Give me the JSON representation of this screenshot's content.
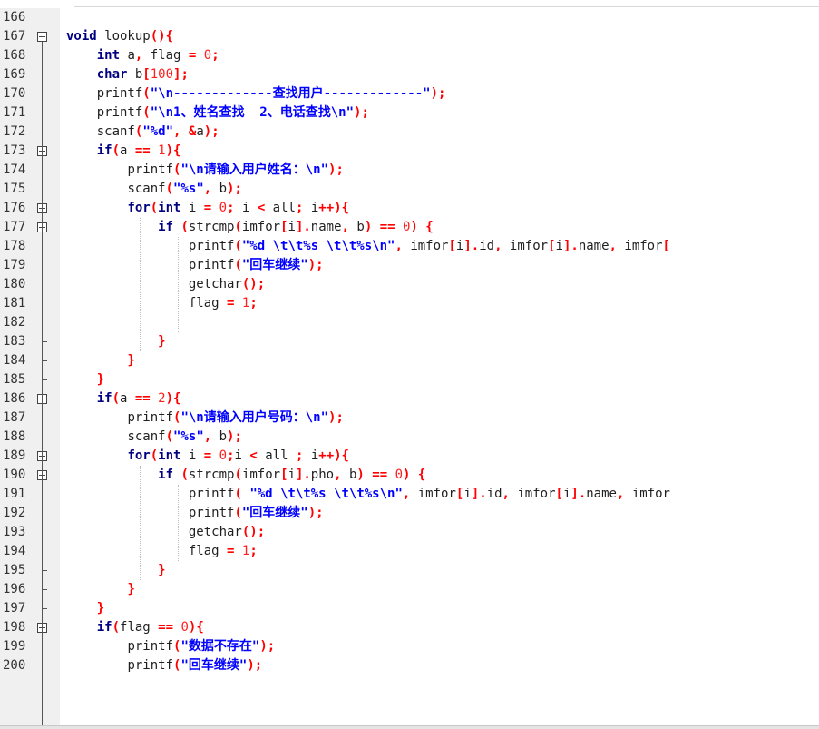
{
  "colors": {
    "keyword": "#000080",
    "string": "#0000ff",
    "number": "#ff2020",
    "operator": "#ff0000",
    "identifier": "#1f1f1f",
    "line_number": "#333333",
    "gutter_bg": "#f0f0f0"
  },
  "editor": {
    "lines": [
      {
        "num": "166",
        "tokens": []
      },
      {
        "num": "167",
        "tokens": [
          [
            "void",
            "k"
          ],
          [
            " lookup",
            ""
          ],
          [
            "(){",
            "o"
          ]
        ]
      },
      {
        "num": "168",
        "tokens": [
          [
            "    ",
            ""
          ],
          [
            "int",
            "k"
          ],
          [
            " a",
            ""
          ],
          [
            ",",
            "o"
          ],
          [
            " flag ",
            ""
          ],
          [
            "=",
            "o"
          ],
          [
            " ",
            ""
          ],
          [
            "0",
            "n"
          ],
          [
            ";",
            "o"
          ]
        ]
      },
      {
        "num": "169",
        "tokens": [
          [
            "    ",
            ""
          ],
          [
            "char",
            "k"
          ],
          [
            " b",
            ""
          ],
          [
            "[",
            "o"
          ],
          [
            "100",
            "n"
          ],
          [
            "];",
            "o"
          ]
        ]
      },
      {
        "num": "170",
        "tokens": [
          [
            "    ",
            ""
          ],
          [
            "printf",
            ""
          ],
          [
            "(",
            "o"
          ],
          [
            "\"\\n-------------查找用户-------------\"",
            "s"
          ],
          [
            ");",
            "o"
          ]
        ]
      },
      {
        "num": "171",
        "tokens": [
          [
            "    ",
            ""
          ],
          [
            "printf",
            ""
          ],
          [
            "(",
            "o"
          ],
          [
            "\"\\n1、姓名查找  2、电话查找\\n\"",
            "s"
          ],
          [
            ");",
            "o"
          ]
        ]
      },
      {
        "num": "172",
        "tokens": [
          [
            "    ",
            ""
          ],
          [
            "scanf",
            ""
          ],
          [
            "(",
            "o"
          ],
          [
            "\"%d\"",
            "s"
          ],
          [
            ",",
            "o"
          ],
          [
            " ",
            ""
          ],
          [
            "&",
            "o"
          ],
          [
            "a",
            ""
          ],
          [
            ");",
            "o"
          ]
        ]
      },
      {
        "num": "173",
        "tokens": [
          [
            "    ",
            ""
          ],
          [
            "if",
            "k"
          ],
          [
            "(",
            "o"
          ],
          [
            "a ",
            ""
          ],
          [
            "==",
            "o"
          ],
          [
            " ",
            ""
          ],
          [
            "1",
            "n"
          ],
          [
            "){",
            "o"
          ]
        ]
      },
      {
        "num": "174",
        "tokens": [
          [
            "        ",
            ""
          ],
          [
            "printf",
            ""
          ],
          [
            "(",
            "o"
          ],
          [
            "\"\\n请输入用户姓名：\\n\"",
            "s"
          ],
          [
            ");",
            "o"
          ]
        ]
      },
      {
        "num": "175",
        "tokens": [
          [
            "        ",
            ""
          ],
          [
            "scanf",
            ""
          ],
          [
            "(",
            "o"
          ],
          [
            "\"%s\"",
            "s"
          ],
          [
            ",",
            "o"
          ],
          [
            " b",
            ""
          ],
          [
            ");",
            "o"
          ]
        ]
      },
      {
        "num": "176",
        "tokens": [
          [
            "        ",
            ""
          ],
          [
            "for",
            "k"
          ],
          [
            "(",
            "o"
          ],
          [
            "int",
            "k"
          ],
          [
            " i ",
            ""
          ],
          [
            "=",
            "o"
          ],
          [
            " ",
            ""
          ],
          [
            "0",
            "n"
          ],
          [
            ";",
            "o"
          ],
          [
            " i ",
            ""
          ],
          [
            "<",
            "o"
          ],
          [
            " all",
            ""
          ],
          [
            ";",
            "o"
          ],
          [
            " i",
            ""
          ],
          [
            "++){",
            "o"
          ]
        ]
      },
      {
        "num": "177",
        "tokens": [
          [
            "            ",
            ""
          ],
          [
            "if",
            "k"
          ],
          [
            " ",
            ""
          ],
          [
            "(",
            "o"
          ],
          [
            "strcmp",
            ""
          ],
          [
            "(",
            "o"
          ],
          [
            "imfor",
            ""
          ],
          [
            "[",
            "o"
          ],
          [
            "i",
            ""
          ],
          [
            "].",
            "o"
          ],
          [
            "name",
            ""
          ],
          [
            ",",
            "o"
          ],
          [
            " b",
            ""
          ],
          [
            ")",
            "o"
          ],
          [
            " ",
            ""
          ],
          [
            "==",
            "o"
          ],
          [
            " ",
            ""
          ],
          [
            "0",
            "n"
          ],
          [
            ")",
            "o"
          ],
          [
            " ",
            ""
          ],
          [
            "{",
            "o"
          ]
        ]
      },
      {
        "num": "178",
        "tokens": [
          [
            "                ",
            ""
          ],
          [
            "printf",
            ""
          ],
          [
            "(",
            "o"
          ],
          [
            "\"%d \\t\\t%s \\t\\t%s\\n\"",
            "s"
          ],
          [
            ",",
            "o"
          ],
          [
            " imfor",
            ""
          ],
          [
            "[",
            "o"
          ],
          [
            "i",
            ""
          ],
          [
            "].",
            "o"
          ],
          [
            "id",
            ""
          ],
          [
            ",",
            "o"
          ],
          [
            " imfor",
            ""
          ],
          [
            "[",
            "o"
          ],
          [
            "i",
            ""
          ],
          [
            "].",
            "o"
          ],
          [
            "name",
            ""
          ],
          [
            ",",
            "o"
          ],
          [
            " imfor",
            ""
          ],
          [
            "[",
            "o"
          ]
        ]
      },
      {
        "num": "179",
        "tokens": [
          [
            "                ",
            ""
          ],
          [
            "printf",
            ""
          ],
          [
            "(",
            "o"
          ],
          [
            "\"回车继续\"",
            "s"
          ],
          [
            ");",
            "o"
          ]
        ]
      },
      {
        "num": "180",
        "tokens": [
          [
            "                ",
            ""
          ],
          [
            "getchar",
            ""
          ],
          [
            "();",
            "o"
          ]
        ]
      },
      {
        "num": "181",
        "tokens": [
          [
            "                ",
            ""
          ],
          [
            "flag ",
            ""
          ],
          [
            "=",
            "o"
          ],
          [
            " ",
            ""
          ],
          [
            "1",
            "n"
          ],
          [
            ";",
            "o"
          ]
        ]
      },
      {
        "num": "182",
        "tokens": []
      },
      {
        "num": "183",
        "tokens": [
          [
            "            ",
            ""
          ],
          [
            "}",
            "o"
          ]
        ]
      },
      {
        "num": "184",
        "tokens": [
          [
            "        ",
            ""
          ],
          [
            "}",
            "o"
          ]
        ]
      },
      {
        "num": "185",
        "tokens": [
          [
            "    ",
            ""
          ],
          [
            "}",
            "o"
          ]
        ]
      },
      {
        "num": "186",
        "tokens": [
          [
            "    ",
            ""
          ],
          [
            "if",
            "k"
          ],
          [
            "(",
            "o"
          ],
          [
            "a ",
            ""
          ],
          [
            "==",
            "o"
          ],
          [
            " ",
            ""
          ],
          [
            "2",
            "n"
          ],
          [
            "){",
            "o"
          ]
        ]
      },
      {
        "num": "187",
        "tokens": [
          [
            "        ",
            ""
          ],
          [
            "printf",
            ""
          ],
          [
            "(",
            "o"
          ],
          [
            "\"\\n请输入用户号码：\\n\"",
            "s"
          ],
          [
            ");",
            "o"
          ]
        ]
      },
      {
        "num": "188",
        "tokens": [
          [
            "        ",
            ""
          ],
          [
            "scanf",
            ""
          ],
          [
            "(",
            "o"
          ],
          [
            "\"%s\"",
            "s"
          ],
          [
            ",",
            "o"
          ],
          [
            " b",
            ""
          ],
          [
            ");",
            "o"
          ]
        ]
      },
      {
        "num": "189",
        "tokens": [
          [
            "        ",
            ""
          ],
          [
            "for",
            "k"
          ],
          [
            "(",
            "o"
          ],
          [
            "int",
            "k"
          ],
          [
            " i ",
            ""
          ],
          [
            "=",
            "o"
          ],
          [
            " ",
            ""
          ],
          [
            "0",
            "n"
          ],
          [
            ";",
            "o"
          ],
          [
            "i ",
            ""
          ],
          [
            "<",
            "o"
          ],
          [
            " all ",
            ""
          ],
          [
            ";",
            "o"
          ],
          [
            " i",
            ""
          ],
          [
            "++){",
            "o"
          ]
        ]
      },
      {
        "num": "190",
        "tokens": [
          [
            "            ",
            ""
          ],
          [
            "if",
            "k"
          ],
          [
            " ",
            ""
          ],
          [
            "(",
            "o"
          ],
          [
            "strcmp",
            ""
          ],
          [
            "(",
            "o"
          ],
          [
            "imfor",
            ""
          ],
          [
            "[",
            "o"
          ],
          [
            "i",
            ""
          ],
          [
            "].",
            "o"
          ],
          [
            "pho",
            ""
          ],
          [
            ",",
            "o"
          ],
          [
            " b",
            ""
          ],
          [
            ")",
            "o"
          ],
          [
            " ",
            ""
          ],
          [
            "==",
            "o"
          ],
          [
            " ",
            ""
          ],
          [
            "0",
            "n"
          ],
          [
            ")",
            "o"
          ],
          [
            " ",
            ""
          ],
          [
            "{",
            "o"
          ]
        ]
      },
      {
        "num": "191",
        "tokens": [
          [
            "                ",
            ""
          ],
          [
            "printf",
            ""
          ],
          [
            "(",
            "o"
          ],
          [
            " ",
            ""
          ],
          [
            "\"%d \\t\\t%s \\t\\t%s\\n\"",
            "s"
          ],
          [
            ",",
            "o"
          ],
          [
            " imfor",
            ""
          ],
          [
            "[",
            "o"
          ],
          [
            "i",
            ""
          ],
          [
            "].",
            "o"
          ],
          [
            "id",
            ""
          ],
          [
            ",",
            "o"
          ],
          [
            " imfor",
            ""
          ],
          [
            "[",
            "o"
          ],
          [
            "i",
            ""
          ],
          [
            "].",
            "o"
          ],
          [
            "name",
            ""
          ],
          [
            ",",
            "o"
          ],
          [
            " imfor",
            ""
          ]
        ]
      },
      {
        "num": "192",
        "tokens": [
          [
            "                ",
            ""
          ],
          [
            "printf",
            ""
          ],
          [
            "(",
            "o"
          ],
          [
            "\"回车继续\"",
            "s"
          ],
          [
            ");",
            "o"
          ]
        ]
      },
      {
        "num": "193",
        "tokens": [
          [
            "                ",
            ""
          ],
          [
            "getchar",
            ""
          ],
          [
            "();",
            "o"
          ]
        ]
      },
      {
        "num": "194",
        "tokens": [
          [
            "                ",
            ""
          ],
          [
            "flag ",
            ""
          ],
          [
            "=",
            "o"
          ],
          [
            " ",
            ""
          ],
          [
            "1",
            "n"
          ],
          [
            ";",
            "o"
          ]
        ]
      },
      {
        "num": "195",
        "tokens": [
          [
            "            ",
            ""
          ],
          [
            "}",
            "o"
          ]
        ]
      },
      {
        "num": "196",
        "tokens": [
          [
            "        ",
            ""
          ],
          [
            "}",
            "o"
          ]
        ]
      },
      {
        "num": "197",
        "tokens": [
          [
            "    ",
            ""
          ],
          [
            "}",
            "o"
          ]
        ]
      },
      {
        "num": "198",
        "tokens": [
          [
            "    ",
            ""
          ],
          [
            "if",
            "k"
          ],
          [
            "(",
            "o"
          ],
          [
            "flag ",
            ""
          ],
          [
            "==",
            "o"
          ],
          [
            " ",
            ""
          ],
          [
            "0",
            "n"
          ],
          [
            "){",
            "o"
          ]
        ]
      },
      {
        "num": "199",
        "tokens": [
          [
            "        ",
            ""
          ],
          [
            "printf",
            ""
          ],
          [
            "(",
            "o"
          ],
          [
            "\"数据不存在\"",
            "s"
          ],
          [
            ");",
            "o"
          ]
        ]
      },
      {
        "num": "200",
        "tokens": [
          [
            "        ",
            ""
          ],
          [
            "printf",
            ""
          ],
          [
            "(",
            "o"
          ],
          [
            "\"回车继续\"",
            "s"
          ],
          [
            ");",
            "o"
          ]
        ]
      }
    ]
  }
}
